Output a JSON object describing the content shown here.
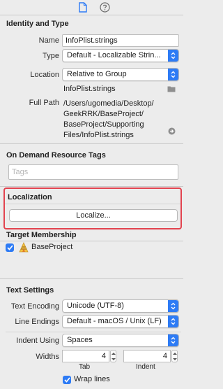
{
  "toolbar": {
    "file_inspector_icon": "doc-icon",
    "quick_help_icon": "help-icon"
  },
  "identity": {
    "title": "Identity and Type",
    "name_label": "Name",
    "name_value": "InfoPlist.strings",
    "type_label": "Type",
    "type_value": "Default - Localizable Strin...",
    "location_label": "Location",
    "location_value": "Relative to Group",
    "location_filename": "InfoPlist.strings",
    "fullpath_label": "Full Path",
    "fullpath_lines": [
      "/Users/ugomedia/Desktop/",
      "GeekRRK/BaseProject/",
      "BaseProject/Supporting",
      "Files/InfoPlist.strings"
    ]
  },
  "odr": {
    "title": "On Demand Resource Tags",
    "tags_placeholder": "Tags"
  },
  "localization": {
    "title": "Localization",
    "button_label": "Localize..."
  },
  "membership": {
    "title": "Target Membership",
    "target_name": "BaseProject",
    "checked": true
  },
  "text_settings": {
    "title": "Text Settings",
    "encoding_label": "Text Encoding",
    "encoding_value": "Unicode (UTF-8)",
    "line_endings_label": "Line Endings",
    "line_endings_value": "Default - macOS / Unix (LF)",
    "indent_using_label": "Indent Using",
    "indent_using_value": "Spaces",
    "widths_label": "Widths",
    "tab_width": "4",
    "indent_width": "4",
    "tab_caption": "Tab",
    "indent_caption": "Indent",
    "wrap_lines_label": "Wrap lines",
    "wrap_lines_checked": true
  },
  "colors": {
    "accent": "#2d7bf5",
    "highlight": "#e2434f",
    "panel_bg": "#ececec"
  }
}
